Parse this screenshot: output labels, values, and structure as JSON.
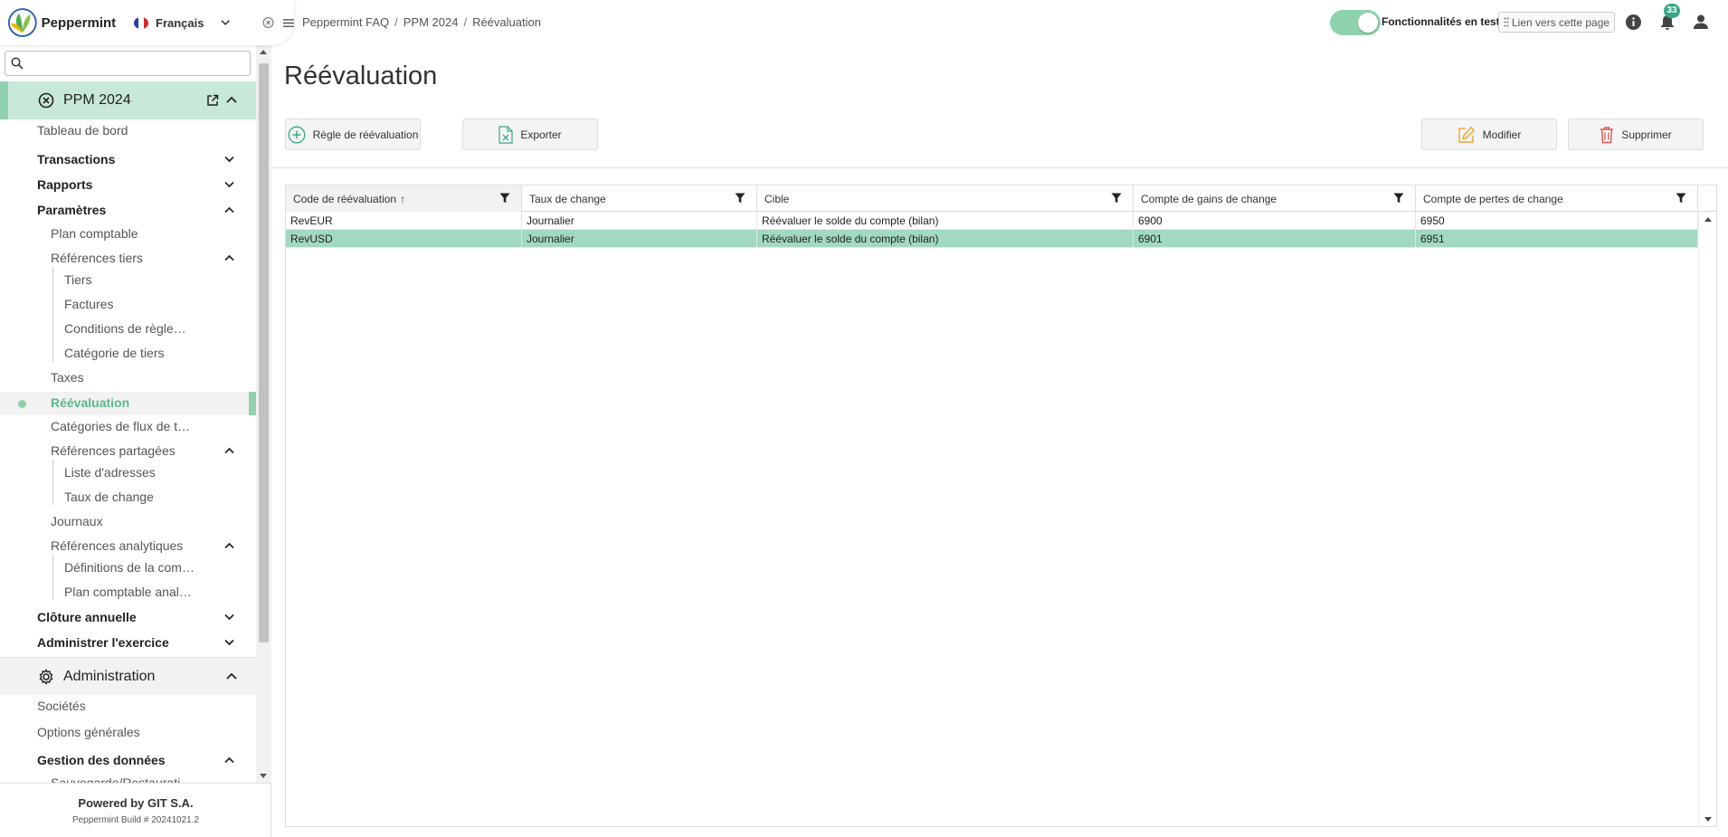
{
  "app": {
    "name": "Peppermint",
    "language": "Français"
  },
  "sidebar": {
    "search_placeholder": "",
    "project": {
      "label": "PPM 2024"
    },
    "items": {
      "dashboard": "Tableau de bord",
      "transactions": "Transactions",
      "reports": "Rapports",
      "parameters": "Paramètres",
      "chart_of_accounts": "Plan comptable",
      "third_party_refs": "Références tiers",
      "third_parties": "Tiers",
      "invoices": "Factures",
      "payment_terms": "Conditions de règle…",
      "third_party_category": "Catégorie de tiers",
      "taxes": "Taxes",
      "revaluation": "Réévaluation",
      "cash_flow_categories": "Catégories de flux de t…",
      "shared_refs": "Références partagées",
      "address_list": "Liste d'adresses",
      "exchange_rates": "Taux de change",
      "journals": "Journaux",
      "analytic_refs": "Références analytiques",
      "definitions": "Définitions de la com…",
      "analytic_chart": "Plan comptable anal…",
      "year_closing": "Clôture annuelle",
      "manage_year": "Administrer l'exercice"
    },
    "admin": {
      "label": "Administration",
      "companies": "Sociétés",
      "general_options": "Options générales",
      "data_management": "Gestion des données",
      "backup": "Sauvegarde/Restaurati…"
    },
    "footer": {
      "powered": "Powered by GIT S.A.",
      "build": "Peppermint Build # 20241021.2"
    }
  },
  "breadcrumb": [
    "Peppermint FAQ",
    "PPM 2024",
    "Réévaluation"
  ],
  "topbar": {
    "beta_label": "Fonctionnalités en test",
    "page_link": "Lien vers cette page",
    "notifications": "33"
  },
  "page": {
    "title": "Réévaluation",
    "buttons": {
      "add_rule": "Règle de réévaluation",
      "export": "Exporter",
      "edit": "Modifier",
      "delete": "Supprimer"
    }
  },
  "table": {
    "columns": [
      "Code de réévaluation",
      "Taux de change",
      "Cible",
      "Compte de gains de change",
      "Compte de pertes de change"
    ],
    "sort_indicator": "↑",
    "rows": [
      [
        "RevEUR",
        "Journalier",
        "Réévaluer le solde du compte (bilan)",
        "6900",
        "6950"
      ],
      [
        "RevUSD",
        "Journalier",
        "Réévaluer le solde du compte (bilan)",
        "6901",
        "6951"
      ]
    ],
    "selected_row": 1
  },
  "colors": {
    "accent": "#3aa68a",
    "section_bg": "#c8e8d9",
    "selected_row": "#a2d9c0",
    "active_item": "#5ab88f",
    "edit_icon": "#f0a830",
    "delete_icon": "#e05555"
  }
}
